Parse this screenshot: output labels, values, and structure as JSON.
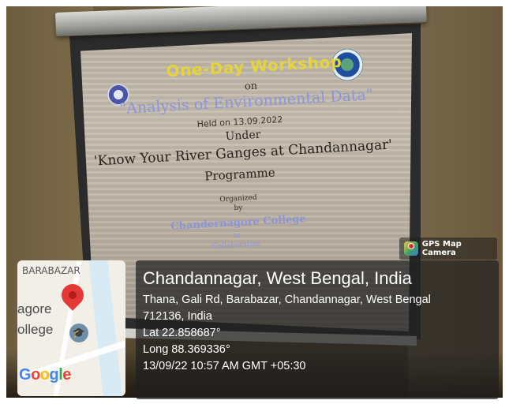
{
  "slide": {
    "workshop_title": "One-Day Workshop",
    "on": "on",
    "analysis": "\"Analysis of Environmental Data\"",
    "held_on": "Held on 13.09.2022",
    "under": "Under",
    "programme_name": "'Know Your River Ganges at Chandannagar'",
    "programme": "Programme",
    "organized": "Organized",
    "by": "by",
    "college": "Chandernagore College",
    "in": "in",
    "collaboration": "Collaboration"
  },
  "gps_badge": {
    "label": "GPS Map Camera",
    "icon": "map-pin-app-icon"
  },
  "map": {
    "area_label": "BARABAZAR",
    "label_line1": "agore",
    "label_line2": "ollege",
    "google_letters": [
      "G",
      "o",
      "o",
      "g",
      "l",
      "e"
    ],
    "google_colors": [
      "#4285F4",
      "#EA4335",
      "#FBBC05",
      "#4285F4",
      "#34A853",
      "#EA4335"
    ],
    "pin_icon": "location-pin-icon",
    "school_icon": "graduation-cap-icon"
  },
  "location": {
    "title": "Chandannagar, West Bengal, India",
    "address_line1": "Thana, Gali Rd, Barabazar, Chandannagar, West Bengal",
    "address_line2": "712136, India",
    "lat": "Lat 22.858687°",
    "long": "Long 88.369336°",
    "timestamp": "13/09/22 10:57 AM GMT +05:30"
  }
}
